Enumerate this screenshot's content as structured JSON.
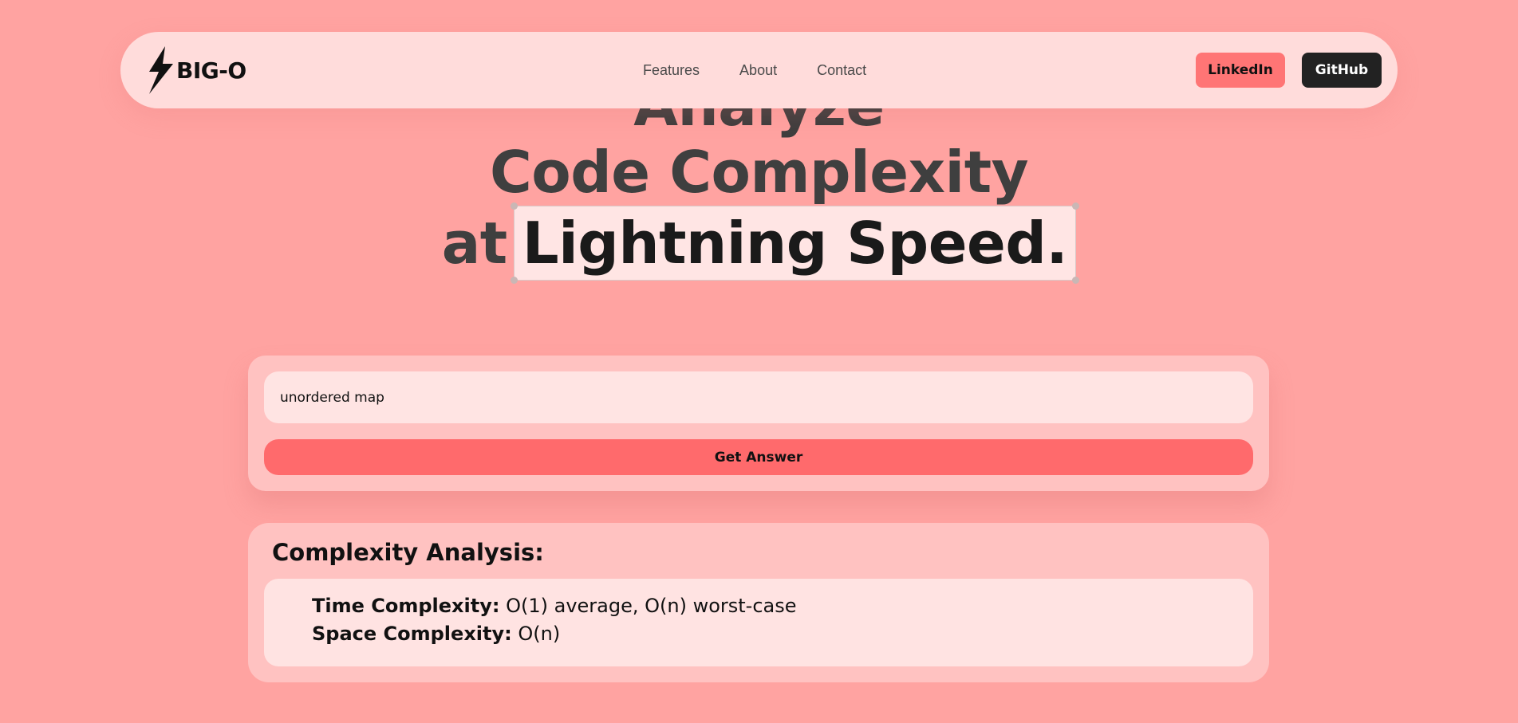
{
  "brand": {
    "name": "BIG-O",
    "logo_icon": "lightning-bolt-icon"
  },
  "nav": {
    "links": [
      "Features",
      "About",
      "Contact"
    ],
    "linkedin_label": "LinkedIn",
    "github_label": "GitHub"
  },
  "hero": {
    "line1": "Analyze",
    "line2": "Code Complexity",
    "line3_prefix": "at",
    "line3_highlight": "Lightning Speed."
  },
  "query": {
    "value": "unordered map",
    "button_label": "Get Answer"
  },
  "result": {
    "title": "Complexity Analysis:",
    "time_label": "Time Complexity:",
    "time_value": "O(1) average, O(n) worst-case",
    "space_label": "Space Complexity:",
    "space_value": "O(n)"
  },
  "colors": {
    "background": "#ffa3a1",
    "navbar": "#ffdcdb",
    "accent": "#ff6a6c",
    "linkedin_button": "#ff7575",
    "github_button": "#222222"
  }
}
